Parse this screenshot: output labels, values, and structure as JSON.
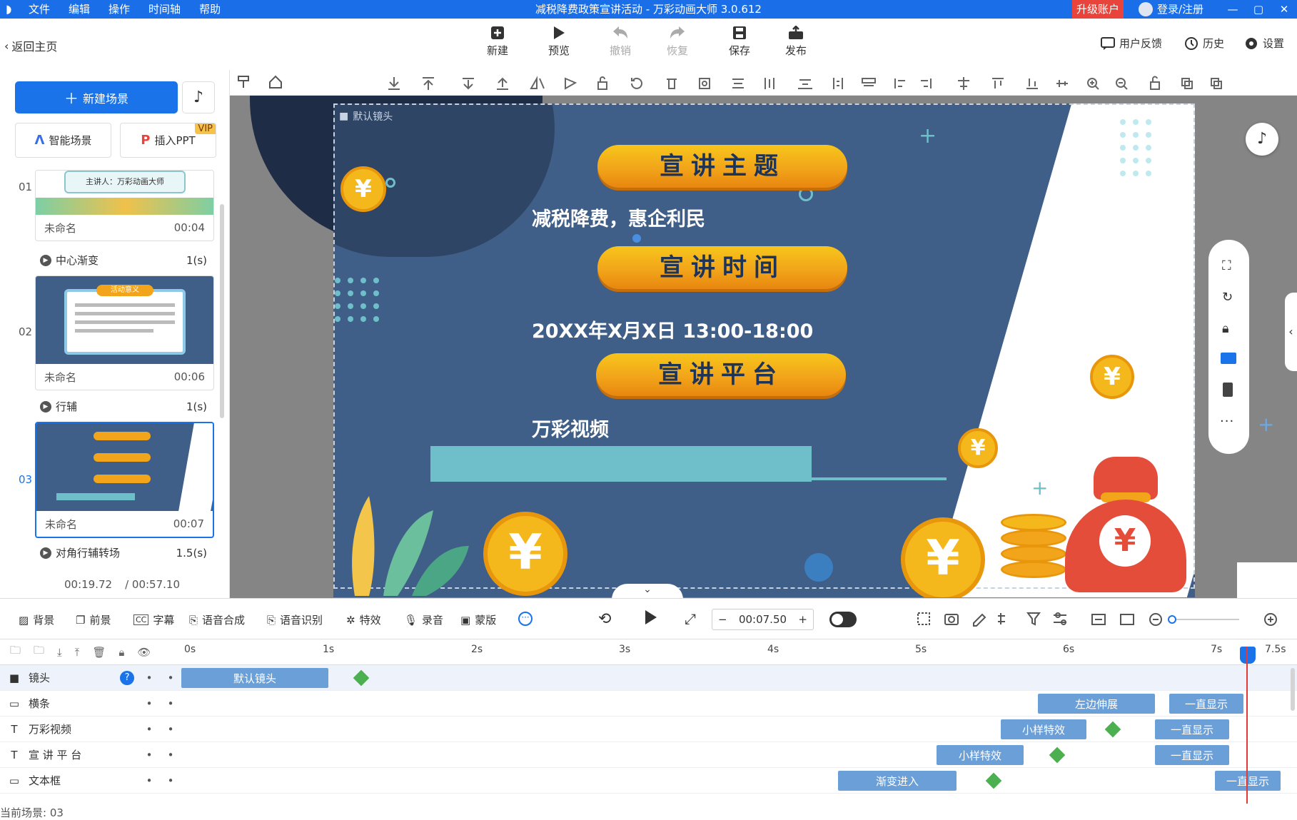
{
  "titlebar": {
    "menu": [
      "文件",
      "编辑",
      "操作",
      "时间轴",
      "帮助"
    ],
    "title": "减税降费政策宣讲活动 - 万彩动画大师 3.0.612",
    "upgrade": "升级账户",
    "login": "登录/注册",
    "window_buttons": [
      "—",
      "▢",
      "✕"
    ]
  },
  "toolbar": {
    "back": "返回主页",
    "buttons": [
      {
        "label": "新建",
        "icon": "plus-box-icon"
      },
      {
        "label": "预览",
        "icon": "play-icon"
      },
      {
        "label": "撤销",
        "icon": "undo-icon"
      },
      {
        "label": "恢复",
        "icon": "redo-icon"
      },
      {
        "label": "保存",
        "icon": "save-icon"
      },
      {
        "label": "发布",
        "icon": "publish-icon"
      }
    ],
    "right": [
      {
        "label": "用户反馈",
        "icon": "feedback-icon"
      },
      {
        "label": "历史",
        "icon": "history-icon"
      },
      {
        "label": "设置",
        "icon": "gear-icon"
      }
    ]
  },
  "left_panel": {
    "new_scene": "新建场景",
    "smart_scene": "智能场景",
    "insert_ppt": "插入PPT",
    "vip": "VIP",
    "scenes": [
      {
        "num": "01",
        "name": "未命名",
        "duration": "00:04",
        "transition": "中心渐变",
        "trans_time": "1(s)",
        "host_text": "主讲人：万彩动画大师"
      },
      {
        "num": "02",
        "name": "未命名",
        "duration": "00:06",
        "transition": "行辅",
        "trans_time": "1(s)",
        "banner": "活动意义"
      },
      {
        "num": "03",
        "name": "未命名",
        "duration": "00:07",
        "transition": "对角行辅转场",
        "trans_time": "1.5(s)"
      }
    ],
    "current_time": "00:19.72",
    "total_time": "/ 00:57.10"
  },
  "canvas": {
    "camera_label": "默认镜头",
    "title1": "宣讲主题",
    "subtitle1": "减税降费，惠企利民",
    "title2": "宣讲时间",
    "subtitle2": "20XX年X月X日 13:00-18:00",
    "title3": "宣讲平台",
    "subtitle3": "万彩视频",
    "yuan": "¥"
  },
  "timeline_controls": {
    "buttons": [
      "背景",
      "前景",
      "字幕",
      "语音合成",
      "语音识别",
      "特效",
      "录音",
      "蒙版"
    ],
    "time": "00:07.50",
    "minus": "−",
    "plus": "+"
  },
  "ruler": [
    "0s",
    "1s",
    "2s",
    "3s",
    "4s",
    "5s",
    "6s",
    "7s",
    "7.5s"
  ],
  "tracks": [
    {
      "name": "镜头",
      "icon": "camera-icon",
      "clips": [
        {
          "label": "默认镜头"
        }
      ]
    },
    {
      "name": "横条",
      "icon": "image-icon",
      "clips": [
        {
          "label": "左边伸展"
        },
        {
          "label": "一直显示"
        }
      ]
    },
    {
      "name": "万彩视频",
      "icon": "text-icon",
      "clips": [
        {
          "label": "小样特效"
        },
        {
          "label": "一直显示"
        }
      ]
    },
    {
      "name": "宣 讲 平 台",
      "icon": "text-icon",
      "clips": [
        {
          "label": "小样特效"
        },
        {
          "label": "一直显示"
        }
      ]
    },
    {
      "name": "文本框",
      "icon": "image-icon",
      "clips": [
        {
          "label": "渐变进入"
        },
        {
          "label": "一直显示"
        }
      ]
    }
  ],
  "status": "当前场景: 03",
  "colors": {
    "accent": "#1a73e8",
    "titlebar": "#1a6fe8",
    "scene_bg": "#3f5f88",
    "pill": "#f2a51a",
    "clip": "#6b9fd8"
  }
}
